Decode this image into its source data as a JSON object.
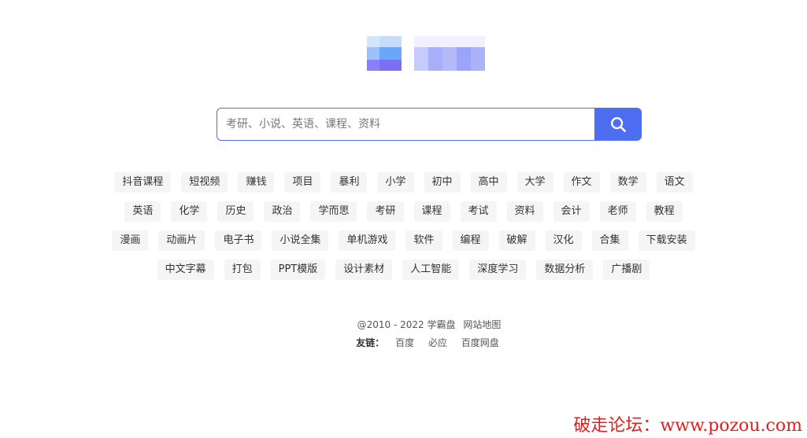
{
  "search": {
    "placeholder": "考研、小说、英语、课程、资料"
  },
  "tags": [
    [
      "抖音课程",
      "短视频",
      "赚钱",
      "项目",
      "暴利",
      "小学",
      "初中",
      "高中",
      "大学",
      "作文",
      "数学",
      "语文"
    ],
    [
      "英语",
      "化学",
      "历史",
      "政治",
      "学而思",
      "考研",
      "课程",
      "考试",
      "资料",
      "会计",
      "老师",
      "教程"
    ],
    [
      "漫画",
      "动画片",
      "电子书",
      "小说全集",
      "单机游戏",
      "软件",
      "编程",
      "破解",
      "汉化",
      "合集",
      "下载安装"
    ],
    [
      "中文字幕",
      "打包",
      "PPT模版",
      "设计素材",
      "人工智能",
      "深度学习",
      "数据分析",
      "广播剧"
    ]
  ],
  "footer": {
    "copyright": "@2010 - 2022 学霸盘",
    "sitemap": "网站地图",
    "links_label": "友链：",
    "links": [
      "百度",
      "必应",
      "百度网盘"
    ]
  },
  "watermark": "破走论坛：www.pozou.com",
  "colors": {
    "accent": "#4e6ef2",
    "tag_bg": "#f5f5f6",
    "watermark": "#e02020"
  }
}
